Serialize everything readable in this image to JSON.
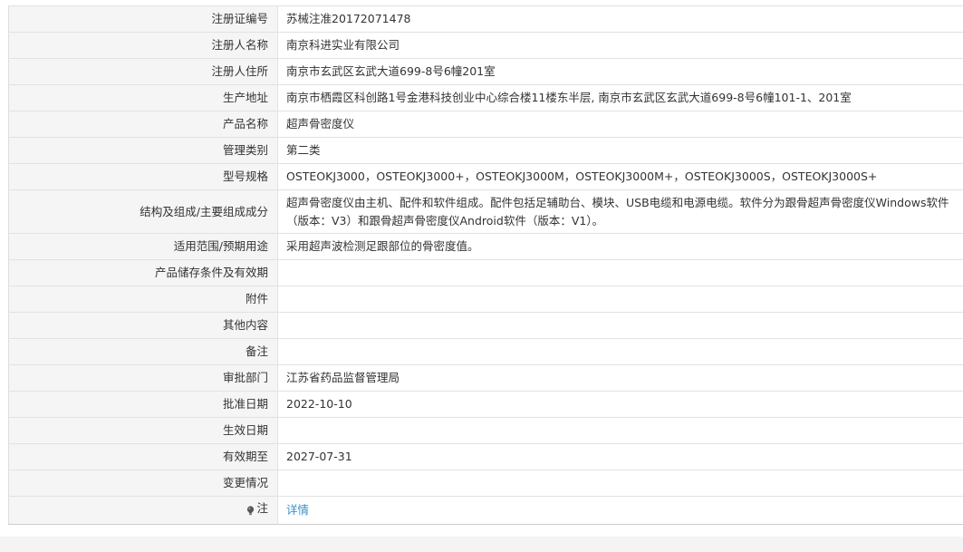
{
  "rows": [
    {
      "label": "注册证编号",
      "value": "苏械注准20172071478"
    },
    {
      "label": "注册人名称",
      "value": "南京科进实业有限公司"
    },
    {
      "label": "注册人住所",
      "value": "南京市玄武区玄武大道699-8号6幢201室"
    },
    {
      "label": "生产地址",
      "value": "南京市栖霞区科创路1号金港科技创业中心综合楼11楼东半层, 南京市玄武区玄武大道699-8号6幢101-1、201室"
    },
    {
      "label": "产品名称",
      "value": "超声骨密度仪"
    },
    {
      "label": "管理类别",
      "value": "第二类"
    },
    {
      "label": "型号规格",
      "value": "OSTEOKJ3000，OSTEOKJ3000+，OSTEOKJ3000M，OSTEOKJ3000M+，OSTEOKJ3000S，OSTEOKJ3000S+"
    },
    {
      "label": "结构及组成/主要组成成分",
      "value": "超声骨密度仪由主机、配件和软件组成。配件包括足辅助台、模块、USB电缆和电源电缆。软件分为跟骨超声骨密度仪Windows软件（版本：V3）和跟骨超声骨密度仪Android软件（版本：V1）。"
    },
    {
      "label": "适用范围/预期用途",
      "value": "采用超声波检测足跟部位的骨密度值。"
    },
    {
      "label": "产品储存条件及有效期",
      "value": ""
    },
    {
      "label": "附件",
      "value": ""
    },
    {
      "label": "其他内容",
      "value": ""
    },
    {
      "label": "备注",
      "value": ""
    },
    {
      "label": "审批部门",
      "value": "江苏省药品监督管理局"
    },
    {
      "label": "批准日期",
      "value": "2022-10-10"
    },
    {
      "label": "生效日期",
      "value": ""
    },
    {
      "label": "有效期至",
      "value": "2027-07-31"
    },
    {
      "label": "变更情况",
      "value": ""
    }
  ],
  "note": {
    "label": "注",
    "icon": "lightbulb-icon",
    "link_text": "详情",
    "link_color": "#3a8fc8"
  }
}
